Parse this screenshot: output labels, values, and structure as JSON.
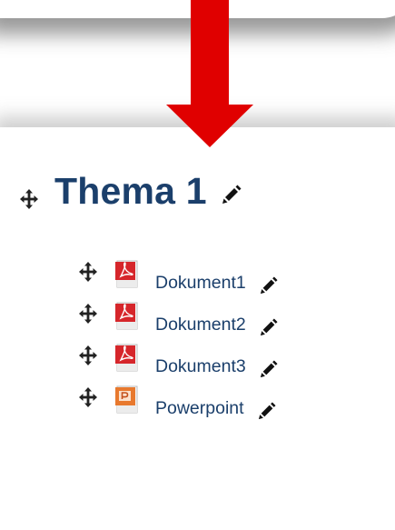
{
  "section": {
    "title": "Thema 1"
  },
  "activities": [
    {
      "name": "Dokument1",
      "icon": "pdf-icon"
    },
    {
      "name": "Dokument2",
      "icon": "pdf-icon"
    },
    {
      "name": "Dokument3",
      "icon": "pdf-icon"
    },
    {
      "name": "Powerpoint",
      "icon": "powerpoint-icon"
    }
  ],
  "colors": {
    "link": "#1b3f6b",
    "arrow": "#e00000",
    "pdf": "#d6262b",
    "ppt": "#e8792e"
  },
  "icons": {
    "move": "move-icon",
    "edit": "pencil-icon",
    "arrow": "arrow-down-icon"
  }
}
